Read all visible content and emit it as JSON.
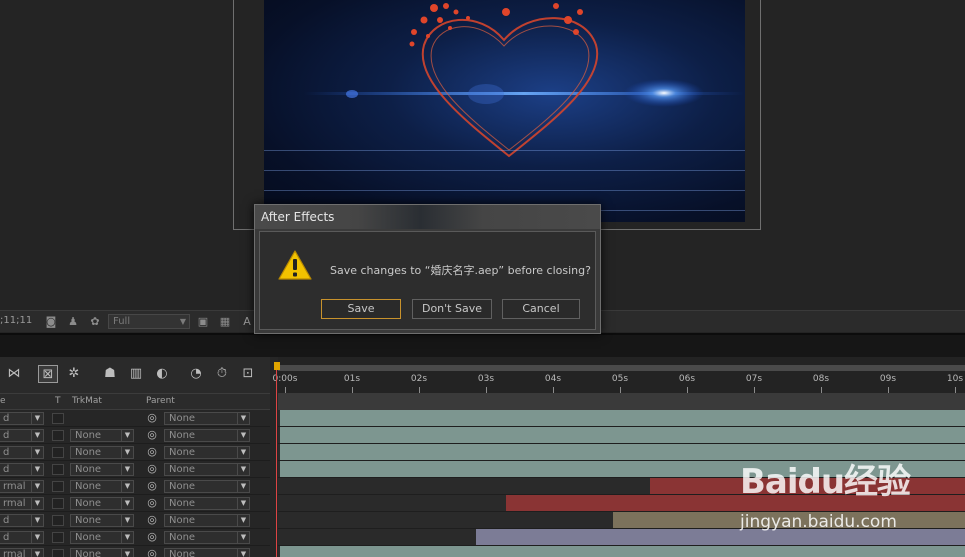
{
  "dialog": {
    "title": "After Effects",
    "message": "Save changes to “婚庆名字.aep” before closing?",
    "buttons": {
      "save": "Save",
      "dont_save": "Don't Save",
      "cancel": "Cancel"
    },
    "accent_color": "#c8922c"
  },
  "viewer": {
    "timecode": ";11;11",
    "resolution": "Full",
    "partial_label": "A"
  },
  "timeline": {
    "columns": {
      "trkmat": "TrkMat",
      "t": "T",
      "parent": "Parent",
      "mode": "e"
    },
    "ruler_labels": [
      "0:00s",
      "01s",
      "02s",
      "03s",
      "04s",
      "05s",
      "06s",
      "07s",
      "08s",
      "09s",
      "10s"
    ],
    "layers": [
      {
        "mode": "d",
        "trkmat": "",
        "parent": "None"
      },
      {
        "mode": "d",
        "trkmat": "None",
        "parent": "None"
      },
      {
        "mode": "d",
        "trkmat": "None",
        "parent": "None"
      },
      {
        "mode": "d",
        "trkmat": "None",
        "parent": "None"
      },
      {
        "mode": "rmal",
        "trkmat": "None",
        "parent": "None"
      },
      {
        "mode": "rmal",
        "trkmat": "None",
        "parent": "None"
      },
      {
        "mode": "d",
        "trkmat": "None",
        "parent": "None"
      },
      {
        "mode": "d",
        "trkmat": "None",
        "parent": "None"
      },
      {
        "mode": "rmal",
        "trkmat": "None",
        "parent": "None"
      }
    ],
    "track_bars": [
      {
        "start": 0.0,
        "end": 10.0,
        "color": "#7d9690"
      },
      {
        "start": 0.0,
        "end": 10.0,
        "color": "#7d9690"
      },
      {
        "start": 0.0,
        "end": 10.0,
        "color": "#7d9690"
      },
      {
        "start": 0.0,
        "end": 10.0,
        "color": "#7d9690"
      },
      {
        "start": 5.45,
        "end": 10.0,
        "color": "#8a3434"
      },
      {
        "start": 3.3,
        "end": 10.0,
        "color": "#8a3434"
      },
      {
        "start": 4.9,
        "end": 10.0,
        "color": "#7c725c"
      },
      {
        "start": 2.85,
        "end": 10.0,
        "color": "#7c7c96"
      },
      {
        "start": 0.0,
        "end": 10.0,
        "color": "#7d9690"
      }
    ]
  },
  "watermark": {
    "logo": "Baidu经验",
    "url": "jingyan.baidu.com"
  }
}
